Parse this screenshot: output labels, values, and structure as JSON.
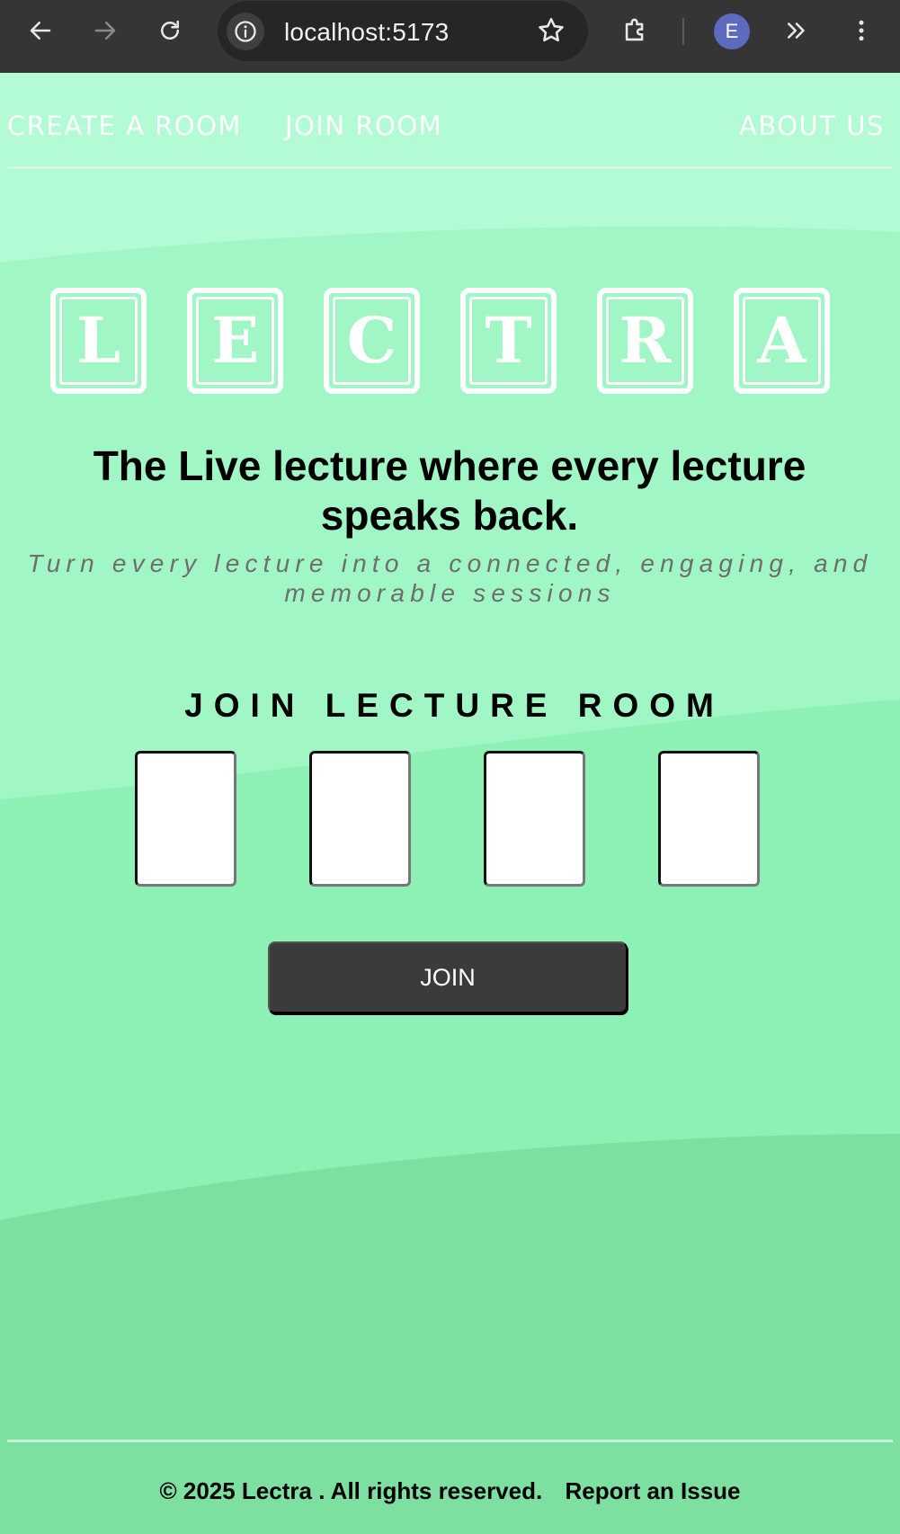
{
  "browser": {
    "url": "localhost:5173",
    "profile_initial": "E",
    "icons": {
      "back": "arrow-left-icon",
      "forward": "arrow-right-icon",
      "reload": "reload-icon",
      "site_info": "info-icon",
      "bookmark": "star-icon",
      "extensions": "puzzle-icon",
      "more_extensions": "double-chevron-icon",
      "menu": "kebab-menu-icon"
    }
  },
  "nav": {
    "create_room": "CREATE A ROOM",
    "join_room": "JOIN ROOM",
    "about_us": "ABOUT US"
  },
  "logo": {
    "letters": [
      "L",
      "E",
      "C",
      "T",
      "R",
      "A"
    ]
  },
  "hero": {
    "headline": "The Live lecture where every lecture speaks back.",
    "subtitle": "Turn every lecture into a connected, engaging, and memorable sessions"
  },
  "join": {
    "title": "JOIN LECTURE ROOM",
    "code_values": [
      "",
      "",
      "",
      ""
    ],
    "button_label": "JOIN"
  },
  "footer": {
    "copyright": "© 2025 Lectra . All rights reserved.",
    "report": "Report an Issue"
  },
  "colors": {
    "page_bg_top": "#b3fbd4",
    "page_bg_mid": "#8df0b5",
    "page_bg_bottom": "#7de0a0",
    "button_bg": "#3b3b3b",
    "chrome_bg": "#353535",
    "avatar_bg": "#5c6bc0"
  }
}
